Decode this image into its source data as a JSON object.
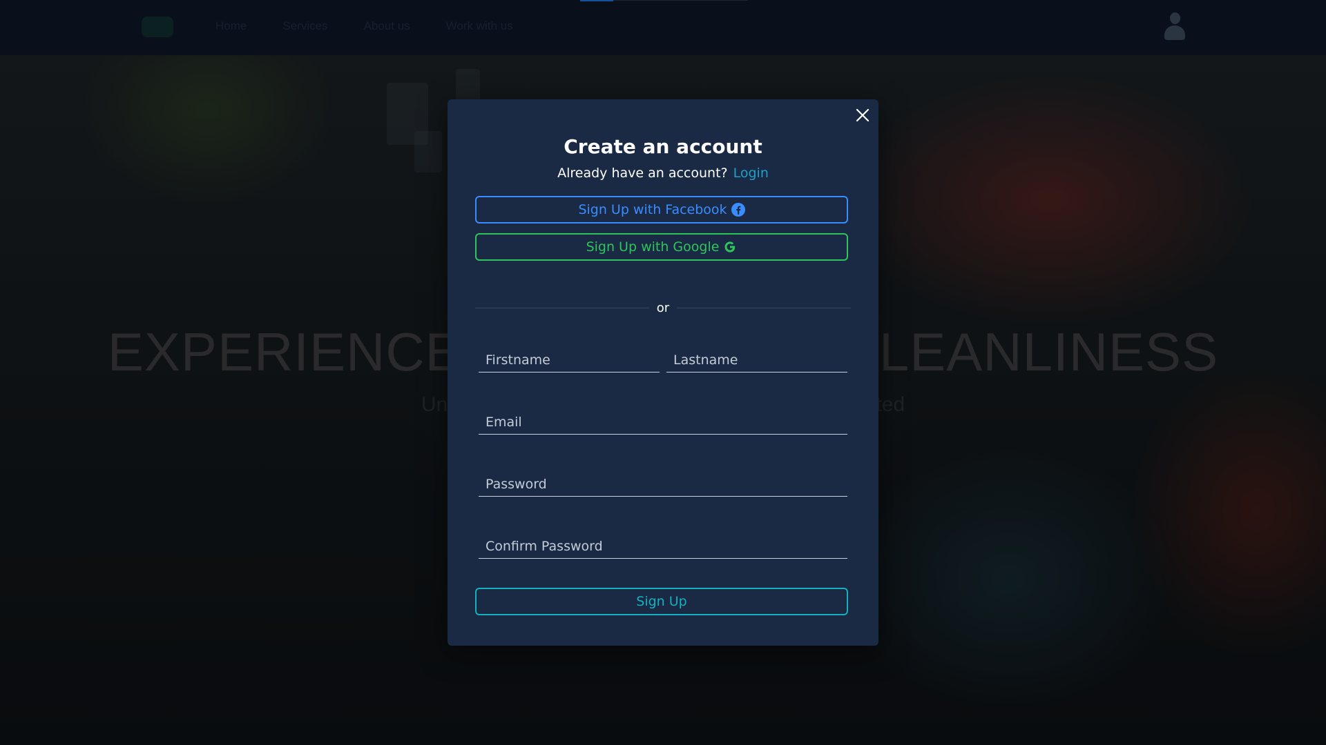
{
  "navbar": {
    "links": [
      "Home",
      "Services",
      "About us",
      "Work with us"
    ]
  },
  "hero": {
    "title": "EXPERIENCE UNMATCHED CLEANLINESS",
    "subtitle": "Unlock a cleaner world with our services. Get started"
  },
  "modal": {
    "title": "Create an account",
    "login_prompt": "Already have an account?",
    "login_link": "Login",
    "facebook_button": "Sign Up with Facebook",
    "google_button": "Sign Up with Google",
    "divider_text": "or",
    "fields": {
      "firstname_placeholder": "Firstname",
      "lastname_placeholder": "Lastname",
      "email_placeholder": "Email",
      "password_placeholder": "Password",
      "confirm_password_placeholder": "Confirm Password"
    },
    "signup_button": "Sign Up"
  },
  "colors": {
    "modal_bg": "#1b2a44",
    "facebook": "#3a8dff",
    "google": "#2ec55a",
    "signup": "#14b2c0",
    "link": "#1ea0c8"
  },
  "icons": {
    "close": "close-icon",
    "facebook": "facebook-icon",
    "google": "google-icon",
    "user": "user-icon"
  }
}
